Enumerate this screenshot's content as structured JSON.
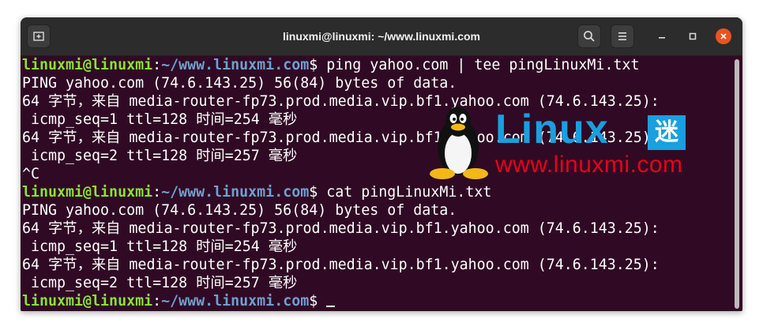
{
  "window": {
    "title": "linuxmi@linuxmi: ~/www.linuxmi.com"
  },
  "prompt": {
    "user": "linuxmi@linuxmi",
    "sep": ":",
    "path": "~/www.linuxmi.com",
    "symbol": "$"
  },
  "lines": [
    {
      "type": "prompt",
      "cmd": " ping yahoo.com | tee pingLinuxMi.txt"
    },
    {
      "type": "out",
      "text": "PING yahoo.com (74.6.143.25) 56(84) bytes of data."
    },
    {
      "type": "out",
      "text": "64 字节，来自 media-router-fp73.prod.media.vip.bf1.yahoo.com (74.6.143.25):"
    },
    {
      "type": "out",
      "text": " icmp_seq=1 ttl=128 时间=254 毫秒"
    },
    {
      "type": "out",
      "text": "64 字节，来自 media-router-fp73.prod.media.vip.bf1.yahoo.com (74.6.143.25):"
    },
    {
      "type": "out",
      "text": " icmp_seq=2 ttl=128 时间=257 毫秒"
    },
    {
      "type": "out",
      "text": "^C"
    },
    {
      "type": "prompt",
      "cmd": " cat pingLinuxMi.txt"
    },
    {
      "type": "out",
      "text": "PING yahoo.com (74.6.143.25) 56(84) bytes of data."
    },
    {
      "type": "out",
      "text": "64 字节，来自 media-router-fp73.prod.media.vip.bf1.yahoo.com (74.6.143.25):"
    },
    {
      "type": "out",
      "text": " icmp_seq=1 ttl=128 时间=254 毫秒"
    },
    {
      "type": "out",
      "text": "64 字节，来自 media-router-fp73.prod.media.vip.bf1.yahoo.com (74.6.143.25):"
    },
    {
      "type": "out",
      "text": " icmp_seq=2 ttl=128 时间=257 毫秒"
    },
    {
      "type": "prompt",
      "cmd": " "
    }
  ],
  "watermark": {
    "brand": "Linux",
    "brand_badge": "迷",
    "url": "www.linuxmi.com"
  },
  "colors": {
    "terminal_bg": "#300a24",
    "user": "#8ae234",
    "path": "#729fcf",
    "titlebar": "#2c2c2c",
    "close": "#e95420"
  },
  "icons": {
    "new_tab": "new-tab-icon",
    "search": "search-icon",
    "menu": "hamburger-menu-icon",
    "minimize": "minimize-icon",
    "maximize": "maximize-icon",
    "close": "close-icon"
  }
}
